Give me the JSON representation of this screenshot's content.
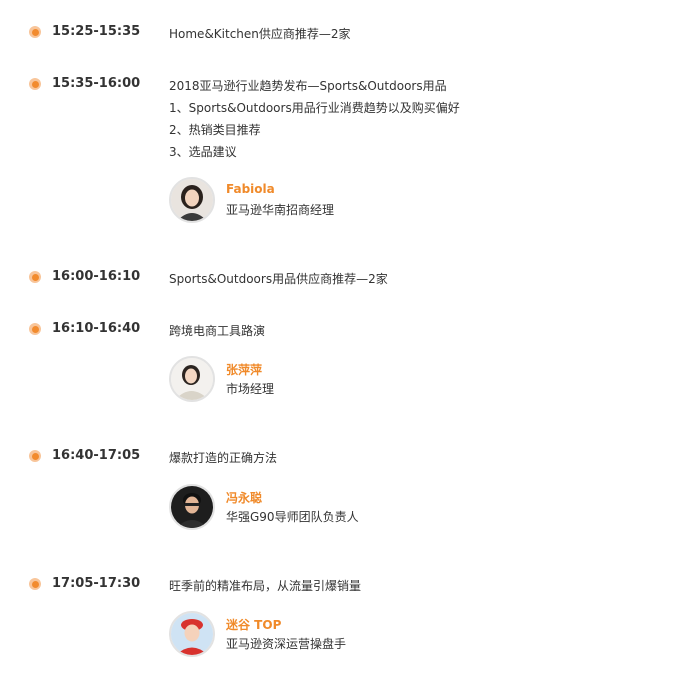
{
  "accent_color": "#f08a2a",
  "dot_color": "#f28b2e",
  "schedule": [
    {
      "time": "15:25-15:35",
      "lines": [
        "Home&Kitchen供应商推荐—2家"
      ]
    },
    {
      "time": "15:35-16:00",
      "lines": [
        "2018亚马逊行业趋势发布—Sports&Outdoors用品",
        "1、Sports&Outdoors用品行业消费趋势以及购买偏好",
        "2、热销类目推荐",
        "3、选品建议"
      ],
      "speaker": {
        "name": "Fabiola",
        "title": "亚马逊华南招商经理"
      }
    },
    {
      "time": "16:00-16:10",
      "lines": [
        "Sports&Outdoors用品供应商推荐—2家"
      ]
    },
    {
      "time": "16:10-16:40",
      "lines": [
        "跨境电商工具路演"
      ],
      "speaker": {
        "name": "张萍萍",
        "title": "市场经理"
      }
    },
    {
      "time": "16:40-17:05",
      "lines": [
        "爆款打造的正确方法"
      ],
      "speaker": {
        "name": "冯永聪",
        "title": "华强G90导师团队负责人"
      }
    },
    {
      "time": "17:05-17:30",
      "lines": [
        "旺季前的精准布局，从流量引爆销量"
      ],
      "speaker": {
        "name": "迷谷 TOP",
        "title": "亚马逊资深运营操盘手"
      }
    }
  ]
}
